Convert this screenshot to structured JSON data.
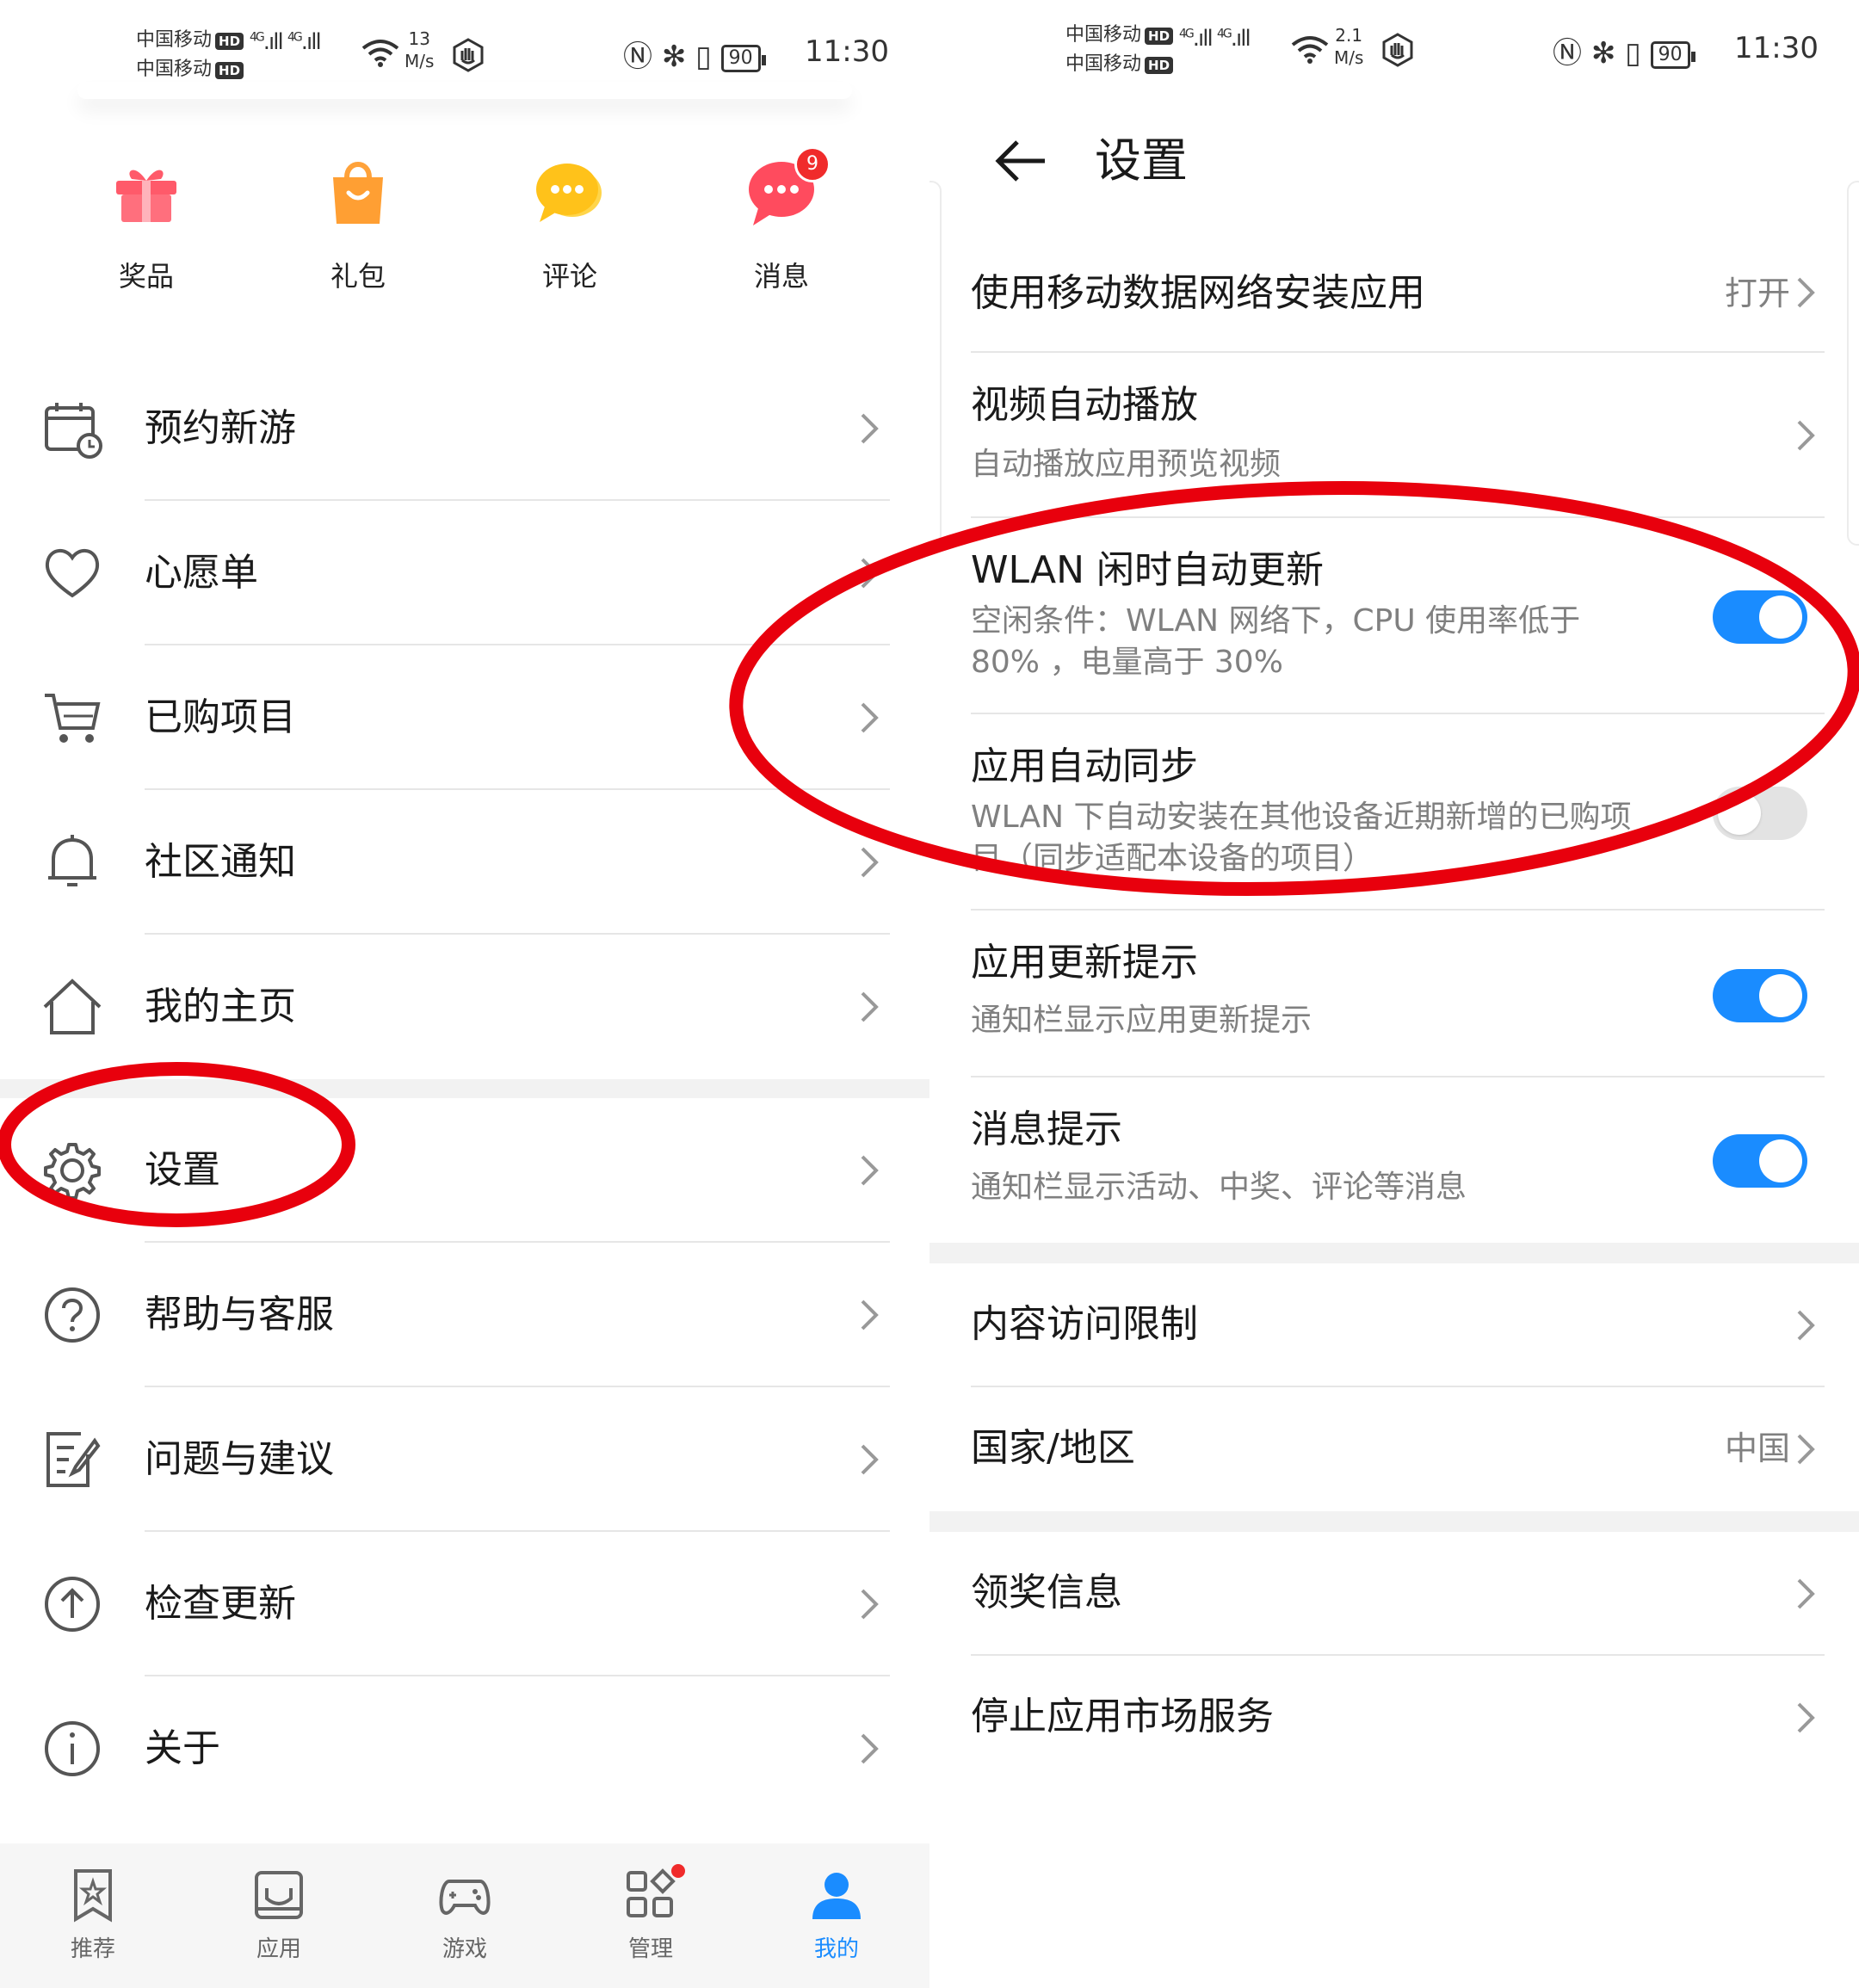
{
  "left": {
    "status": {
      "carrier1": "中国移动",
      "carrier2": "中国移动",
      "hd": "HD",
      "net1": "4G",
      "net2": "4G",
      "speed_value": "13",
      "speed_unit": "M/s",
      "battery": "90",
      "time": "11:30"
    },
    "top_grid": [
      {
        "label": "奖品",
        "icon": "gift-icon"
      },
      {
        "label": "礼包",
        "icon": "shopping-bag-icon"
      },
      {
        "label": "评论",
        "icon": "comment-bubble-icon"
      },
      {
        "label": "消息",
        "icon": "message-bubble-icon",
        "badge": "9"
      }
    ],
    "menu": [
      {
        "label": "预约新游",
        "icon": "calendar-clock-icon"
      },
      {
        "label": "心愿单",
        "icon": "heart-icon"
      },
      {
        "label": "已购项目",
        "icon": "cart-icon"
      },
      {
        "label": "社区通知",
        "icon": "bell-icon"
      },
      {
        "label": "我的主页",
        "icon": "home-icon"
      },
      {
        "label": "设置",
        "icon": "gear-icon"
      },
      {
        "label": "帮助与客服",
        "icon": "help-circle-icon"
      },
      {
        "label": "问题与建议",
        "icon": "feedback-edit-icon"
      },
      {
        "label": "检查更新",
        "icon": "upload-circle-icon"
      },
      {
        "label": "关于",
        "icon": "info-circle-icon"
      }
    ],
    "bottom_nav": [
      {
        "label": "推荐",
        "icon": "star-bookmark-icon",
        "active": false
      },
      {
        "label": "应用",
        "icon": "app-box-icon",
        "active": false
      },
      {
        "label": "游戏",
        "icon": "gamepad-icon",
        "active": false
      },
      {
        "label": "管理",
        "icon": "manage-grid-icon",
        "active": false,
        "dot": true
      },
      {
        "label": "我的",
        "icon": "person-icon",
        "active": true
      }
    ],
    "colors": {
      "accent": "#1a8cff",
      "badge": "#f02b2b"
    }
  },
  "right": {
    "status": {
      "carrier1": "中国移动",
      "carrier2": "中国移动",
      "hd": "HD",
      "net1": "4G",
      "net2": "4G",
      "speed_value": "2.1",
      "speed_unit": "M/s",
      "battery": "90",
      "time": "11:30"
    },
    "title": "设置",
    "mobile_data_install": {
      "label": "使用移动数据网络安装应用",
      "value": "打开"
    },
    "video_autoplay": {
      "label": "视频自动播放",
      "desc": "自动播放应用预览视频"
    },
    "wlan_idle_update": {
      "label": "WLAN 闲时自动更新",
      "desc": "空闲条件：WLAN 网络下，CPU 使用率低于 80% ，电量高于 30%",
      "on": true
    },
    "app_auto_sync": {
      "label": "应用自动同步",
      "desc": "WLAN 下自动安装在其他设备近期新增的已购项目（同步适配本设备的项目）",
      "on": false
    },
    "update_notice": {
      "label": "应用更新提示",
      "desc": "通知栏显示应用更新提示",
      "on": true
    },
    "message_notice": {
      "label": "消息提示",
      "desc": "通知栏显示活动、中奖、评论等消息",
      "on": true
    },
    "content_restriction": {
      "label": "内容访问限制"
    },
    "country_region": {
      "label": "国家/地区",
      "value": "中国"
    },
    "prize_info": {
      "label": "领奖信息"
    },
    "stop_service": {
      "label": "停止应用市场服务"
    },
    "colors": {
      "toggle_on": "#1a8cff",
      "toggle_off": "#e3e3e3",
      "annotation": "#e8000d"
    }
  }
}
